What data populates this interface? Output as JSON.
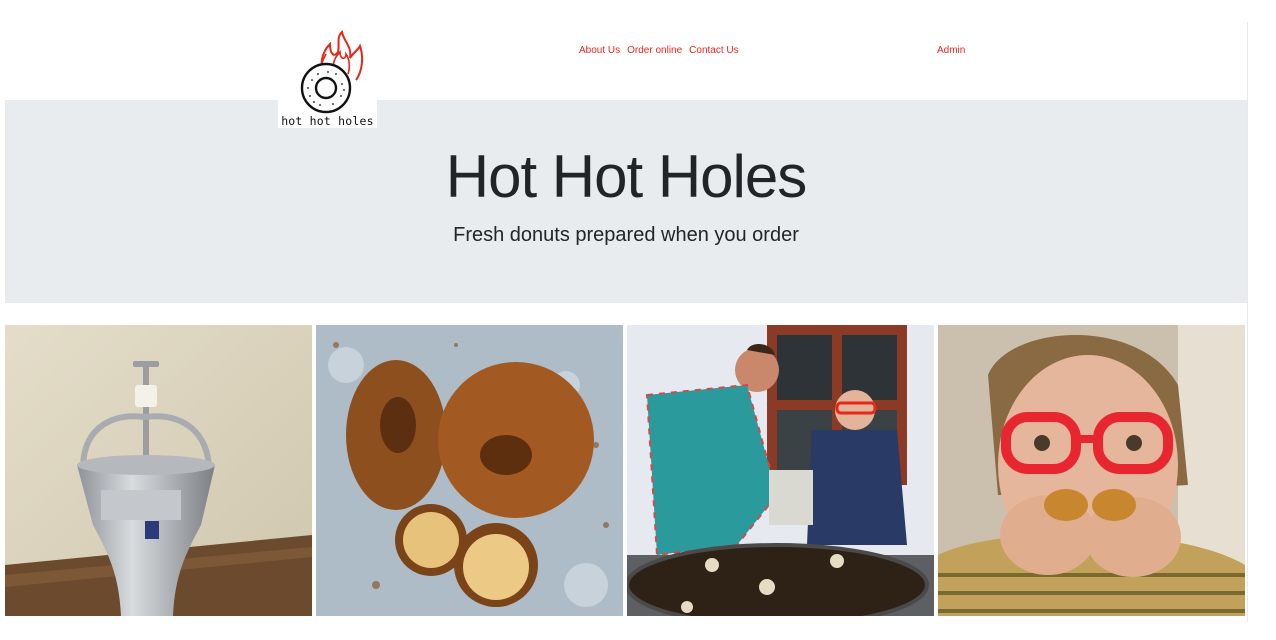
{
  "brand": {
    "logo_text": "hot hot holes"
  },
  "nav": {
    "items": [
      {
        "label": "About Us"
      },
      {
        "label": "Order online"
      },
      {
        "label": "Contact Us"
      }
    ],
    "admin_label": "Admin"
  },
  "hero": {
    "title": "Hot Hot Holes",
    "subtitle": "Fresh donuts prepared when you order"
  },
  "colors": {
    "accent": "#e8261b",
    "hero_bg": "#e9ecef",
    "text": "#212529"
  },
  "gallery": {
    "photos": [
      {
        "name": "donut-dispenser"
      },
      {
        "name": "fried-donuts"
      },
      {
        "name": "frying-donuts-outdoors"
      },
      {
        "name": "woman-eating-donut"
      }
    ]
  }
}
